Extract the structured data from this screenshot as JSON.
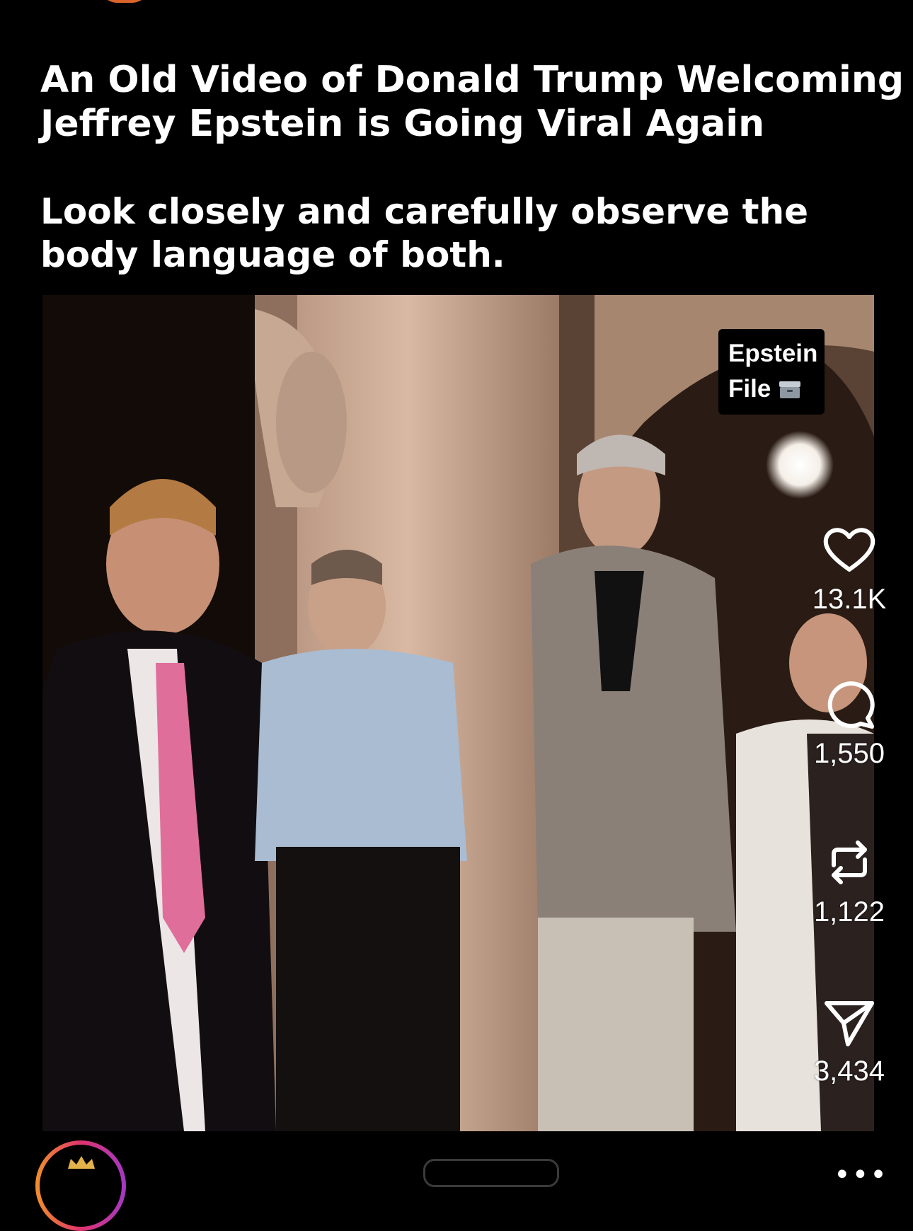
{
  "post": {
    "headline_line1": "An Old Video of Donald Trump Welcoming",
    "headline_line2": "Jeffrey Epstein is Going Viral Again",
    "sub_line1": "Look closely and carefully observe the",
    "sub_line2": "body language of both."
  },
  "video": {
    "overlay_line1": "Epstein",
    "overlay_line2": "File"
  },
  "actions": {
    "likes": "13.1K",
    "comments": "1,550",
    "reposts": "1,122",
    "shares": "3,434"
  },
  "icons": {
    "like": "heart-icon",
    "comment": "comment-bubble-icon",
    "repost": "repost-icon",
    "share": "send-icon",
    "file_box": "card-file-box-icon",
    "more": "more-dots-icon"
  },
  "colors": {
    "background": "#000000",
    "avatar_ring_start": "#f1902a",
    "avatar_ring_mid": "#e0336d",
    "avatar_ring_end": "#a339c4"
  }
}
